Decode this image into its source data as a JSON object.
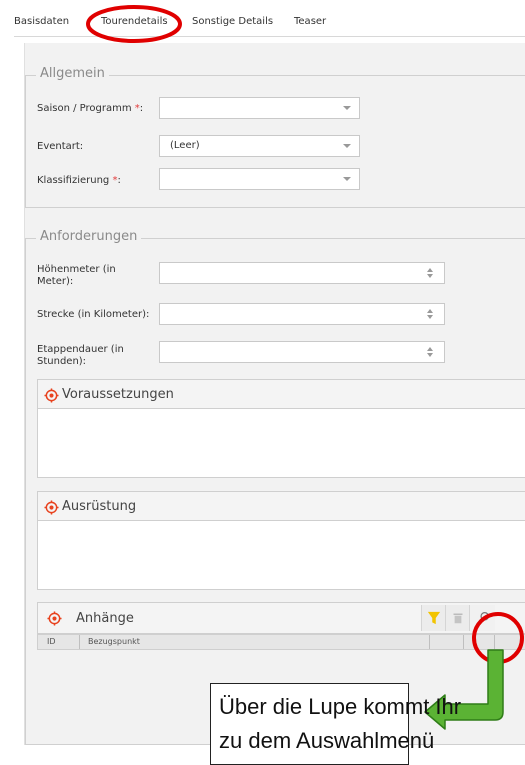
{
  "tabs": [
    {
      "label": "Basisdaten"
    },
    {
      "label": "Tourendetails"
    },
    {
      "label": "Sonstige Details"
    },
    {
      "label": "Teaser"
    }
  ],
  "allgemein": {
    "legend": "Allgemein",
    "fields": [
      {
        "label": "Saison / Programm",
        "required": "*",
        "colon": ":",
        "value": ""
      },
      {
        "label": "Eventart:",
        "value": "(Leer)"
      },
      {
        "label": "Klassifizierung",
        "required": "*",
        "colon": ":",
        "value": ""
      }
    ]
  },
  "anforderungen": {
    "legend": "Anforderungen",
    "fields": [
      {
        "label": "Höhenmeter (in Meter):",
        "value": ""
      },
      {
        "label": "Strecke (in Kilometer):",
        "value": ""
      },
      {
        "label": "Etappendauer (in Stunden):",
        "value": ""
      }
    ]
  },
  "sections": {
    "voraussetzungen": {
      "title": "Voraussetzungen"
    },
    "ausruestung": {
      "title": "Ausrüstung"
    },
    "anhaenge": {
      "title": "Anhänge"
    }
  },
  "grid": {
    "columns": [
      "ID",
      "Bezugspunkt"
    ]
  },
  "annotation": {
    "callout_line1": "Über die Lupe kommt Ihr",
    "callout_line2": "zu dem Auswahlmenü",
    "highlight_color": "#e00000",
    "arrow_color": "#5bb334"
  },
  "colors": {
    "required_star": "#e23b3b",
    "section_icon": "#e8431f",
    "filter_icon": "#f2c400"
  }
}
